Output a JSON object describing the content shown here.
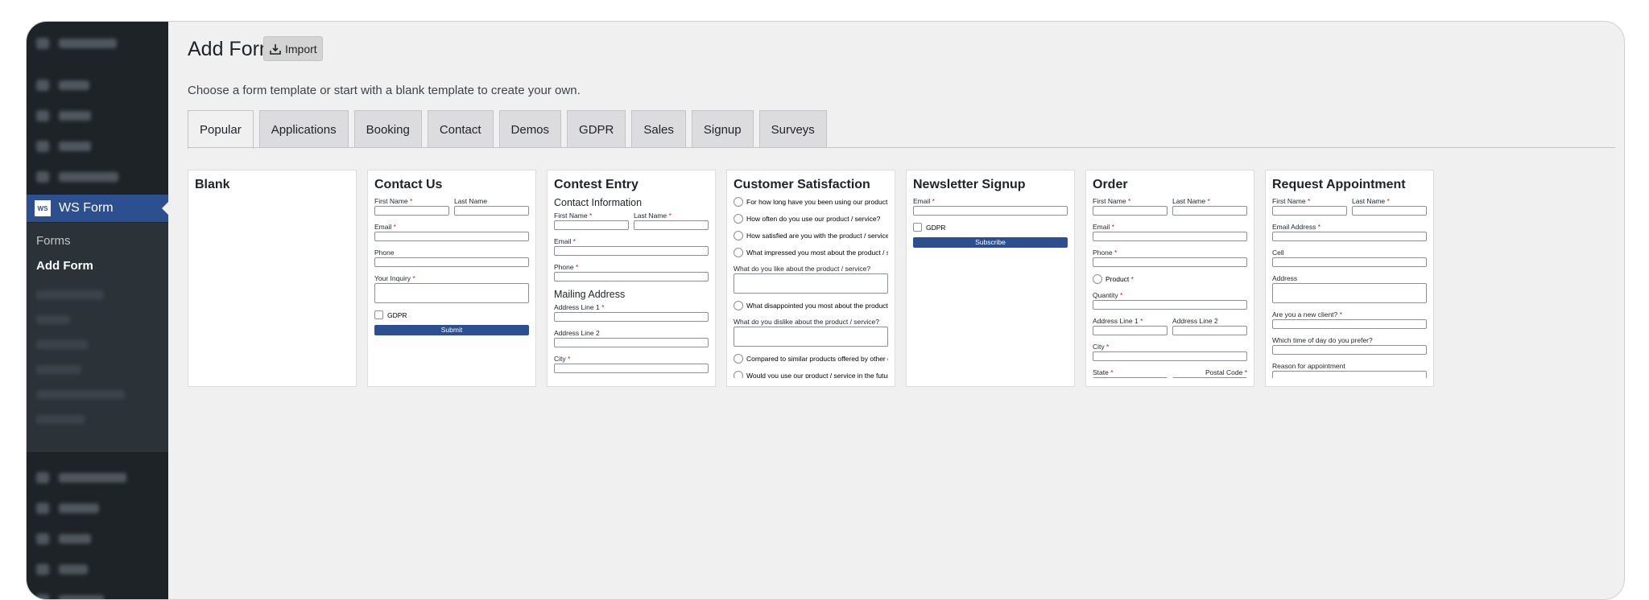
{
  "sidebar": {
    "active_item": "WS Form",
    "ws_logo": "WS",
    "submenu": [
      "Forms",
      "Add Form"
    ]
  },
  "page": {
    "title": "Add Form",
    "import_label": "Import",
    "subtitle": "Choose a form template or start with a blank template to create your own."
  },
  "tabs": [
    "Popular",
    "Applications",
    "Booking",
    "Contact",
    "Demos",
    "GDPR",
    "Sales",
    "Signup",
    "Surveys"
  ],
  "active_tab": "Popular",
  "colors": {
    "accent": "#2c4f8f",
    "required": "#cc1818",
    "sidebar": "#1d2327"
  },
  "templates": {
    "blank": {
      "title": "Blank"
    },
    "contact": {
      "title": "Contact Us",
      "first_name": "First Name",
      "last_name": "Last Name",
      "email": "Email",
      "phone": "Phone",
      "inquiry": "Your Inquiry",
      "gdpr": "GDPR",
      "submit": "Submit"
    },
    "contest": {
      "title": "Contest Entry",
      "contact_info": "Contact Information",
      "first_name": "First Name",
      "last_name": "Last Name",
      "email": "Email",
      "phone": "Phone",
      "mailing": "Mailing Address",
      "addr1": "Address Line 1",
      "addr2": "Address Line 2",
      "city": "City"
    },
    "satisfaction": {
      "title": "Customer Satisfaction",
      "q1": "For how long have you been using our product / service?",
      "q2": "How often do you use our product / service?",
      "q3": "How satisfied are you with the product / service?",
      "q4": "What impressed you most about the product / service?",
      "q5": "What do you like about the product / service?",
      "q6": "What disappointed you most about the product / service?",
      "q7": "What do you dislike about the product / service?",
      "q8": "Compared to similar products offered by other companies",
      "q9": "Would you use our product / service in the future?"
    },
    "newsletter": {
      "title": "Newsletter Signup",
      "email": "Email",
      "gdpr": "GDPR",
      "subscribe": "Subscribe"
    },
    "order": {
      "title": "Order",
      "first_name": "First Name",
      "last_name": "Last Name",
      "email": "Email",
      "phone": "Phone",
      "product": "Product",
      "quantity": "Quantity",
      "addr1": "Address Line 1",
      "addr2": "Address Line 2",
      "city": "City",
      "state": "State",
      "postal": "Postal Code"
    },
    "appointment": {
      "title": "Request Appointment",
      "first_name": "First Name",
      "last_name": "Last Name",
      "email": "Email Address",
      "cell": "Cell",
      "address": "Address",
      "new_client": "Are you a new client?",
      "time": "Which time of day do you prefer?",
      "reason": "Reason for appointment"
    }
  }
}
